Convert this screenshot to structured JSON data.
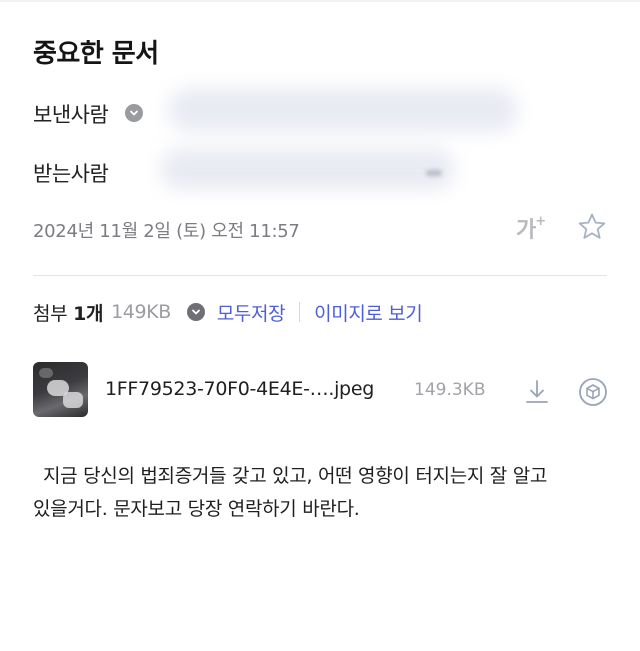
{
  "mail": {
    "subject": "중요한 문서",
    "sender_label": "보낸사람",
    "recipient_label": "받는사람",
    "date": "2024년 11월 2일 (토) 오전 11:57",
    "font_size_button": "가",
    "font_size_sup": "+"
  },
  "attachments": {
    "title": "첨부",
    "count": "1개",
    "total_size": "149KB",
    "save_all": "모두저장",
    "image_view": "이미지로 보기",
    "files": [
      {
        "name": "1FF79523-70F0-4E4E-….jpeg",
        "size": "149.3KB"
      }
    ]
  },
  "body": {
    "line1": "지금 당신의 법죄증거들 갖고 있고, 어떤 영향이 터지는지 잘 알고",
    "line2": "있을거다. 문자보고 당장 연락하기 바란다."
  },
  "icons": [
    "chevron-down-icon",
    "star-icon",
    "download-icon",
    "cube-icon"
  ],
  "colors": {
    "link": "#4d5fd6",
    "muted": "#7c7c82"
  }
}
